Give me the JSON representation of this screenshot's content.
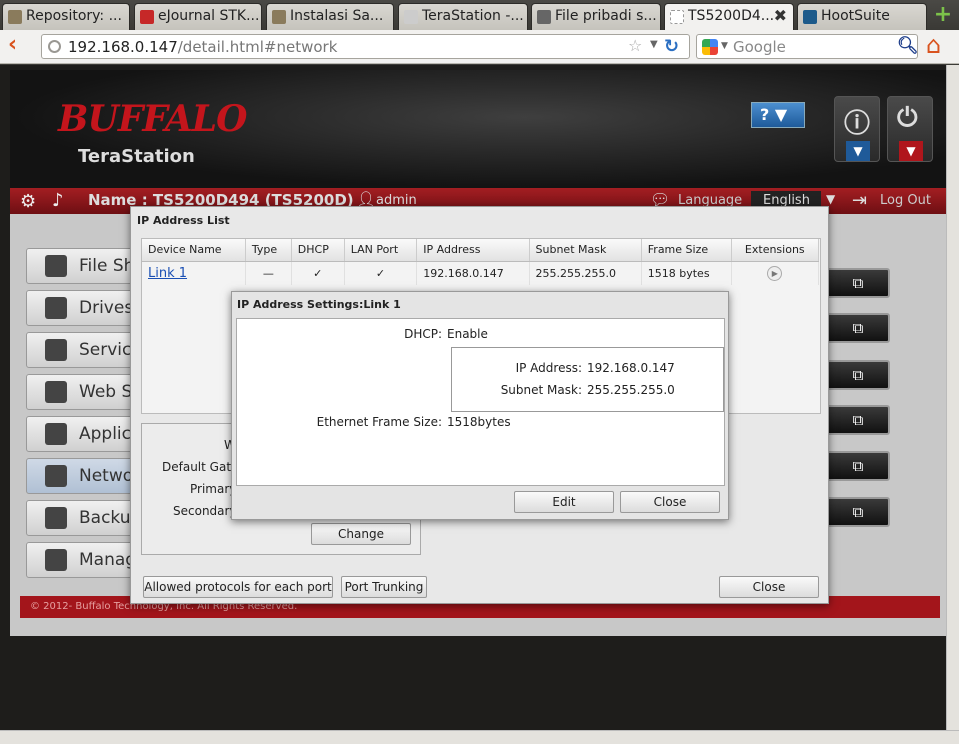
{
  "browser": {
    "tabs": [
      {
        "label": "Repository: ..."
      },
      {
        "label": "eJournal STK..."
      },
      {
        "label": "Instalasi Sa..."
      },
      {
        "label": "TeraStation -..."
      },
      {
        "label": "File pribadi s..."
      },
      {
        "label": "TS5200D4..."
      },
      {
        "label": "HootSuite"
      }
    ],
    "url_host": "192.168.0.147",
    "url_path": "/detail.html#network",
    "search_placeholder": "Google",
    "new_tab": "+",
    "close_tab": "✖"
  },
  "header": {
    "logo": "BUFFALO",
    "subbrand": "TeraStation",
    "help": "? ▼"
  },
  "toolbar": {
    "device_name": "Name : TS5200D494 (TS5200D)",
    "user": "admin",
    "language_label": "Language",
    "language_value": "English",
    "logout": "Log Out"
  },
  "sidebar": {
    "items": [
      {
        "label": "File Sh"
      },
      {
        "label": "Drives"
      },
      {
        "label": "Servic"
      },
      {
        "label": "Web S"
      },
      {
        "label": "Applic"
      },
      {
        "label": "Netwo"
      },
      {
        "label": "Backu"
      },
      {
        "label": "Manag"
      }
    ]
  },
  "footer": "© 2012- Buffalo Technology, Inc. All Rights Reserved.",
  "ip_list_dialog": {
    "title": "IP Address List",
    "columns": [
      "Device Name",
      "Type",
      "DHCP",
      "LAN Port",
      "IP Address",
      "Subnet Mask",
      "Frame Size",
      "Extensions"
    ],
    "rows": [
      {
        "device": "Link 1",
        "type": "—",
        "dhcp": "✓",
        "lan_port": "✓",
        "ip": "192.168.0.147",
        "subnet": "255.255.255.0",
        "frame": "1518 bytes",
        "ext": "▶"
      }
    ],
    "wan_labels": [
      "W",
      "Default Gate",
      "Primary",
      "Secondary"
    ],
    "change_button": "Change",
    "allowed_protocols_button": "Allowed protocols for each port",
    "port_trunking_button": "Port Trunking",
    "close_button": "Close"
  },
  "ip_settings_dialog": {
    "title": "IP Address Settings:Link 1",
    "dhcp_label": "DHCP:",
    "dhcp_value": "Enable",
    "ip_label": "IP Address:",
    "ip_value": "192.168.0.147",
    "subnet_label": "Subnet Mask:",
    "subnet_value": "255.255.255.0",
    "frame_label": "Ethernet Frame Size:",
    "frame_value": "1518bytes",
    "edit_button": "Edit",
    "close_button": "Close"
  }
}
